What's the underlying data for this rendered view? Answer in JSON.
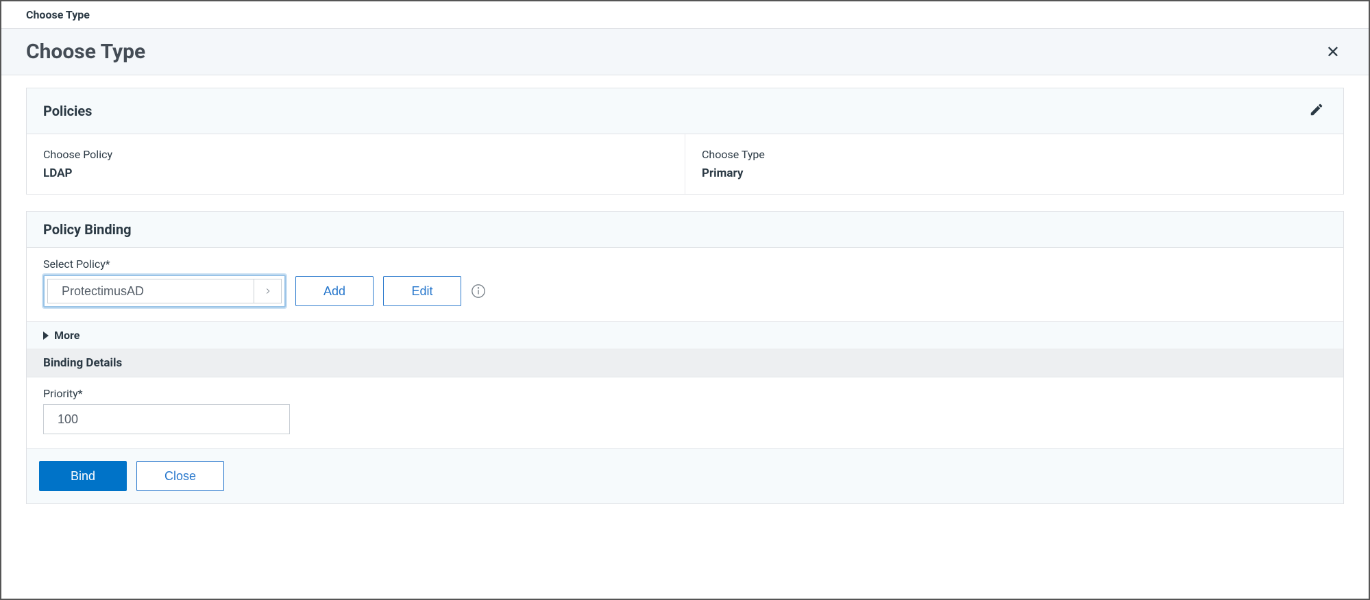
{
  "breadcrumb": "Choose Type",
  "page_title": "Choose Type",
  "policies": {
    "title": "Policies",
    "choose_policy_label": "Choose Policy",
    "choose_policy_value": "LDAP",
    "choose_type_label": "Choose Type",
    "choose_type_value": "Primary"
  },
  "binding": {
    "title": "Policy Binding",
    "select_policy_label": "Select Policy*",
    "select_policy_value": "ProtectimusAD",
    "add_button": "Add",
    "edit_button": "Edit",
    "more_label": "More",
    "details_title": "Binding Details",
    "priority_label": "Priority*",
    "priority_value": "100"
  },
  "footer": {
    "bind_button": "Bind",
    "close_button": "Close"
  }
}
